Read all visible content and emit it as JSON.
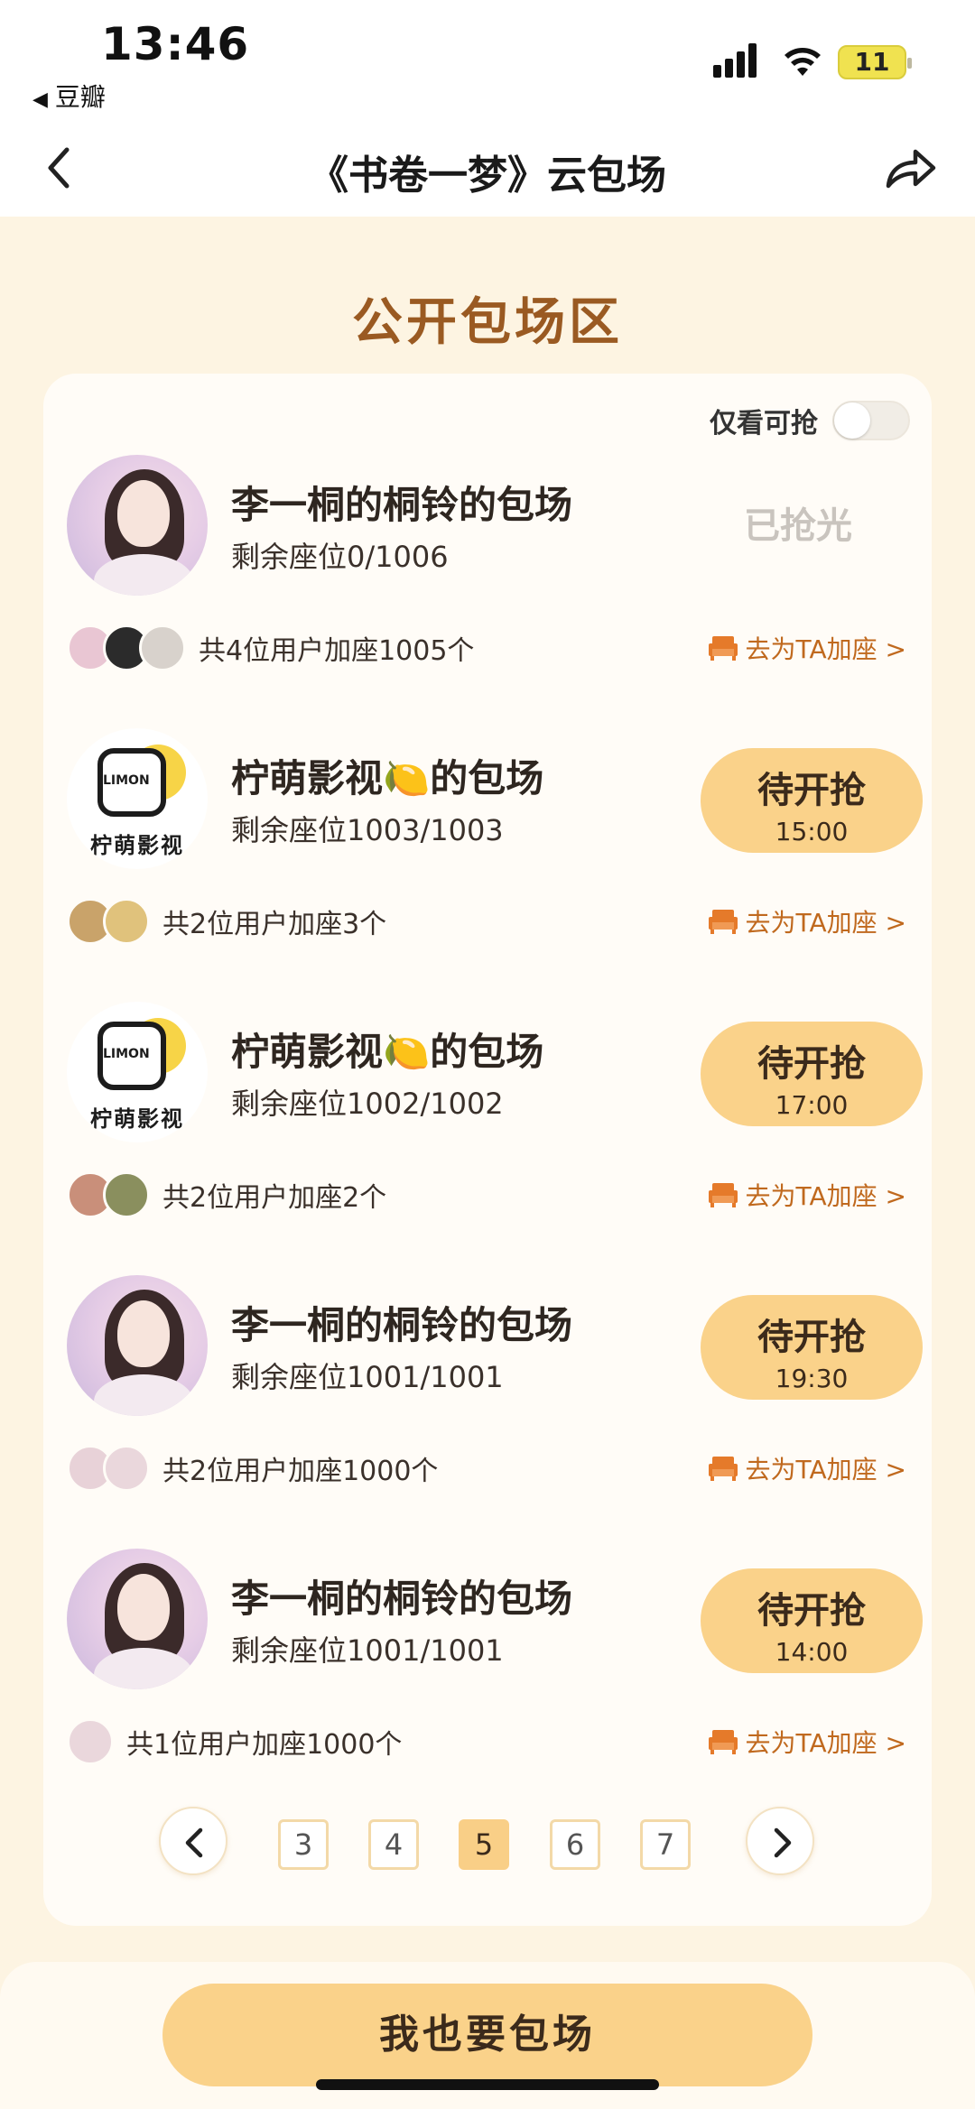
{
  "status_bar": {
    "time": "13:46",
    "back_app": "豆瓣",
    "battery": "11"
  },
  "nav": {
    "title": "《书卷一梦》云包场"
  },
  "section_title": "公开包场区",
  "filter": {
    "label": "仅看可抢",
    "on": false
  },
  "rooms": [
    {
      "avatar": "portrait",
      "title": "李一桐的桐铃的包场",
      "seats": "剩余座位0/1006",
      "state": "已抢光",
      "joiners_text": "共4位用户加座1005个",
      "joiner_count": 3,
      "add_seat": "去为TA加座 >"
    },
    {
      "avatar": "logo",
      "title": "柠萌影视🍋的包场",
      "seats": "剩余座位1003/1003",
      "state_line1": "待开抢",
      "state_line2": "15:00",
      "joiners_text": "共2位用户加座3个",
      "joiner_count": 2,
      "add_seat": "去为TA加座 >"
    },
    {
      "avatar": "logo",
      "title": "柠萌影视🍋的包场",
      "seats": "剩余座位1002/1002",
      "state_line1": "待开抢",
      "state_line2": "17:00",
      "joiners_text": "共2位用户加座2个",
      "joiner_count": 2,
      "add_seat": "去为TA加座 >"
    },
    {
      "avatar": "portrait",
      "title": "李一桐的桐铃的包场",
      "seats": "剩余座位1001/1001",
      "state_line1": "待开抢",
      "state_line2": "19:30",
      "joiners_text": "共2位用户加座1000个",
      "joiner_count": 2,
      "add_seat": "去为TA加座 >"
    },
    {
      "avatar": "portrait",
      "title": "李一桐的桐铃的包场",
      "seats": "剩余座位1001/1001",
      "state_line1": "待开抢",
      "state_line2": "14:00",
      "joiners_text": "共1位用户加座1000个",
      "joiner_count": 1,
      "add_seat": "去为TA加座 >"
    }
  ],
  "logo": {
    "text": "LIMON",
    "caption": "柠萌影视"
  },
  "pagination": {
    "pages": [
      "3",
      "4",
      "5",
      "6",
      "7"
    ],
    "current": "5"
  },
  "bottom_button": "我也要包场",
  "colors": {
    "accent": "#fad28a",
    "heading": "#9a5a22",
    "link": "#c0691e",
    "background": "#fdf4e2"
  }
}
